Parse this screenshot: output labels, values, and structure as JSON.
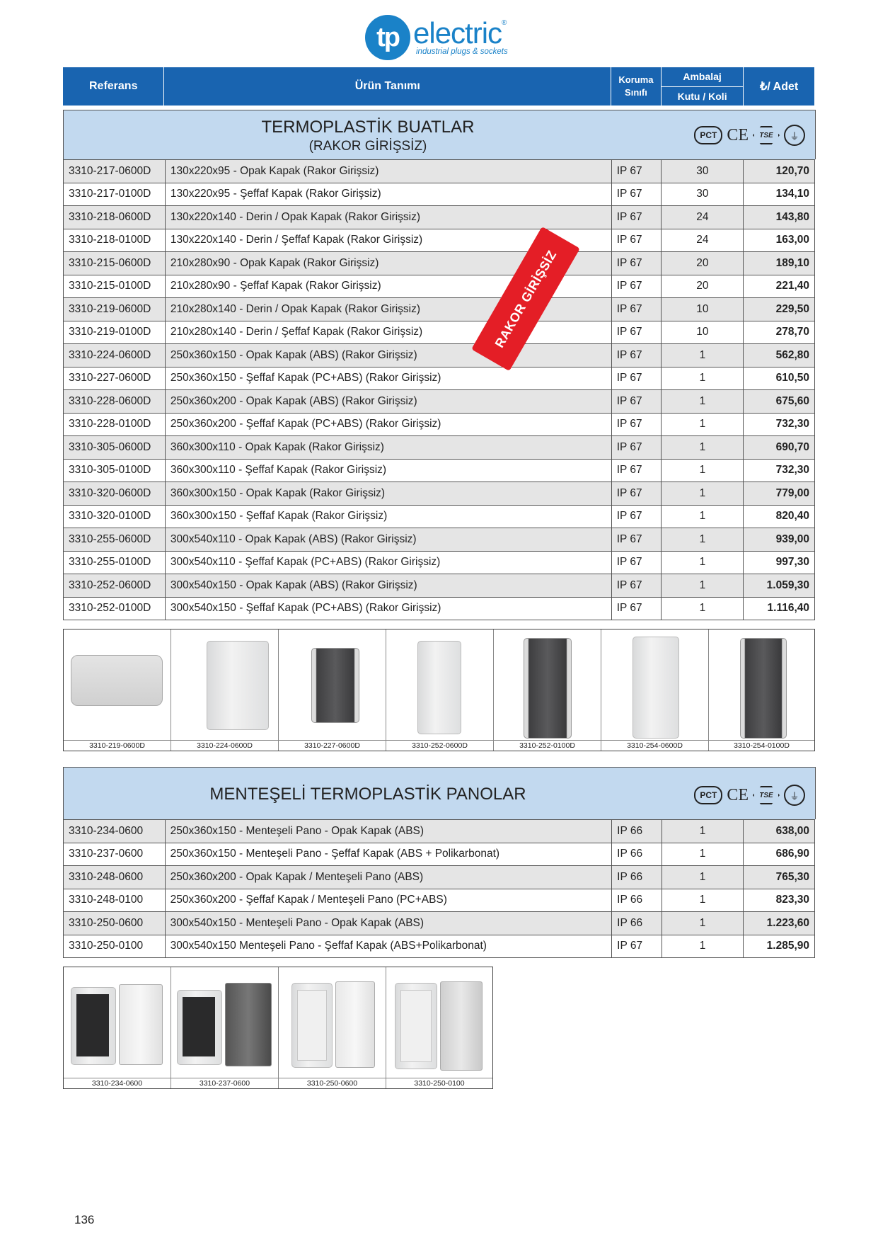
{
  "brand": {
    "mark": "tp",
    "name": "electric",
    "registered": "®",
    "tagline": "industrial plugs & sockets"
  },
  "header": {
    "ref": "Referans",
    "desc": "Ürün Tanımı",
    "ip_line1": "Koruma",
    "ip_line2": "Sınıfı",
    "pack_line1": "Ambalaj",
    "pack_line2": "Kutu / Koli",
    "price": "₺/ Adet"
  },
  "certs": {
    "pct": "PCT",
    "ce": "CE",
    "tse": "TSE",
    "grd": "⏚"
  },
  "section1": {
    "title": "TERMOPLASTİK BUATLAR",
    "subtitle": "(RAKOR GİRİŞSİZ)",
    "stamp": "RAKOR GİRİŞSİZ",
    "rows": [
      {
        "ref": "3310-217-0600D",
        "desc": "130x220x95 - Opak Kapak (Rakor Girişsiz)",
        "ip": "IP 67",
        "pack": "30",
        "price": "120,70"
      },
      {
        "ref": "3310-217-0100D",
        "desc": "130x220x95 - Şeffaf Kapak (Rakor Girişsiz)",
        "ip": "IP 67",
        "pack": "30",
        "price": "134,10"
      },
      {
        "ref": "3310-218-0600D",
        "desc": "130x220x140 - Derin / Opak Kapak (Rakor Girişsiz)",
        "ip": "IP 67",
        "pack": "24",
        "price": "143,80"
      },
      {
        "ref": "3310-218-0100D",
        "desc": "130x220x140 - Derin / Şeffaf Kapak (Rakor Girişsiz)",
        "ip": "IP 67",
        "pack": "24",
        "price": "163,00"
      },
      {
        "ref": "3310-215-0600D",
        "desc": "210x280x90 - Opak Kapak (Rakor Girişsiz)",
        "ip": "IP 67",
        "pack": "20",
        "price": "189,10"
      },
      {
        "ref": "3310-215-0100D",
        "desc": "210x280x90 - Şeffaf Kapak (Rakor Girişsiz)",
        "ip": "IP 67",
        "pack": "20",
        "price": "221,40"
      },
      {
        "ref": "3310-219-0600D",
        "desc": "210x280x140 - Derin / Opak Kapak (Rakor Girişsiz)",
        "ip": "IP 67",
        "pack": "10",
        "price": "229,50"
      },
      {
        "ref": "3310-219-0100D",
        "desc": "210x280x140 - Derin / Şeffaf Kapak (Rakor Girişsiz)",
        "ip": "IP 67",
        "pack": "10",
        "price": "278,70"
      },
      {
        "ref": "3310-224-0600D",
        "desc": "250x360x150 - Opak Kapak (ABS) (Rakor Girişsiz)",
        "ip": "IP 67",
        "pack": "1",
        "price": "562,80"
      },
      {
        "ref": "3310-227-0600D",
        "desc": "250x360x150 - Şeffaf Kapak (PC+ABS) (Rakor Girişsiz)",
        "ip": "IP 67",
        "pack": "1",
        "price": "610,50"
      },
      {
        "ref": "3310-228-0600D",
        "desc": "250x360x200 - Opak Kapak (ABS) (Rakor Girişsiz)",
        "ip": "IP 67",
        "pack": "1",
        "price": "675,60"
      },
      {
        "ref": "3310-228-0100D",
        "desc": "250x360x200 - Şeffaf Kapak (PC+ABS) (Rakor Girişsiz)",
        "ip": "IP 67",
        "pack": "1",
        "price": "732,30"
      },
      {
        "ref": "3310-305-0600D",
        "desc": "360x300x110 - Opak Kapak (Rakor Girişsiz)",
        "ip": "IP 67",
        "pack": "1",
        "price": "690,70"
      },
      {
        "ref": "3310-305-0100D",
        "desc": "360x300x110 - Şeffaf Kapak (Rakor Girişsiz)",
        "ip": "IP 67",
        "pack": "1",
        "price": "732,30"
      },
      {
        "ref": "3310-320-0600D",
        "desc": "360x300x150 - Opak Kapak (Rakor Girişsiz)",
        "ip": "IP 67",
        "pack": "1",
        "price": "779,00"
      },
      {
        "ref": "3310-320-0100D",
        "desc": "360x300x150 - Şeffaf Kapak (Rakor Girişsiz)",
        "ip": "IP 67",
        "pack": "1",
        "price": "820,40"
      },
      {
        "ref": "3310-255-0600D",
        "desc": "300x540x110 - Opak Kapak (ABS) (Rakor Girişsiz)",
        "ip": "IP 67",
        "pack": "1",
        "price": "939,00"
      },
      {
        "ref": "3310-255-0100D",
        "desc": "300x540x110 - Şeffaf Kapak (PC+ABS) (Rakor Girişsiz)",
        "ip": "IP 67",
        "pack": "1",
        "price": "997,30"
      },
      {
        "ref": "3310-252-0600D",
        "desc": "300x540x150 - Opak Kapak (ABS) (Rakor Girişsiz)",
        "ip": "IP 67",
        "pack": "1",
        "price": "1.059,30"
      },
      {
        "ref": "3310-252-0100D",
        "desc": "300x540x150 - Şeffaf Kapak (PC+ABS) (Rakor Girişsiz)",
        "ip": "IP 67",
        "pack": "1",
        "price": "1.116,40"
      }
    ],
    "gallery": [
      "3310-219-0600D",
      "3310-224-0600D",
      "3310-227-0600D",
      "3310-252-0600D",
      "3310-252-0100D",
      "3310-254-0600D",
      "3310-254-0100D"
    ]
  },
  "section2": {
    "title": "MENTEŞELİ TERMOPLASTİK PANOLAR",
    "rows": [
      {
        "ref": "3310-234-0600",
        "desc": "250x360x150 - Menteşeli Pano - Opak Kapak (ABS)",
        "ip": "IP 66",
        "pack": "1",
        "price": "638,00"
      },
      {
        "ref": "3310-237-0600",
        "desc": "250x360x150 - Menteşeli Pano - Şeffaf Kapak (ABS + Polikarbonat)",
        "ip": "IP 66",
        "pack": "1",
        "price": "686,90"
      },
      {
        "ref": "3310-248-0600",
        "desc": "250x360x200 - Opak Kapak / Menteşeli Pano (ABS)",
        "ip": "IP 66",
        "pack": "1",
        "price": "765,30"
      },
      {
        "ref": "3310-248-0100",
        "desc": "250x360x200 - Şeffaf Kapak / Menteşeli Pano (PC+ABS)",
        "ip": "IP 66",
        "pack": "1",
        "price": "823,30"
      },
      {
        "ref": "3310-250-0600",
        "desc": "300x540x150 - Menteşeli Pano - Opak Kapak (ABS)",
        "ip": "IP 66",
        "pack": "1",
        "price": "1.223,60"
      },
      {
        "ref": "3310-250-0100",
        "desc": "300x540x150 Menteşeli Pano - Şeffaf Kapak (ABS+Polikarbonat)",
        "ip": "IP 67",
        "pack": "1",
        "price": "1.285,90"
      }
    ],
    "gallery": [
      "3310-234-0600",
      "3310-237-0600",
      "3310-250-0600",
      "3310-250-0100"
    ]
  },
  "page_number": "136"
}
